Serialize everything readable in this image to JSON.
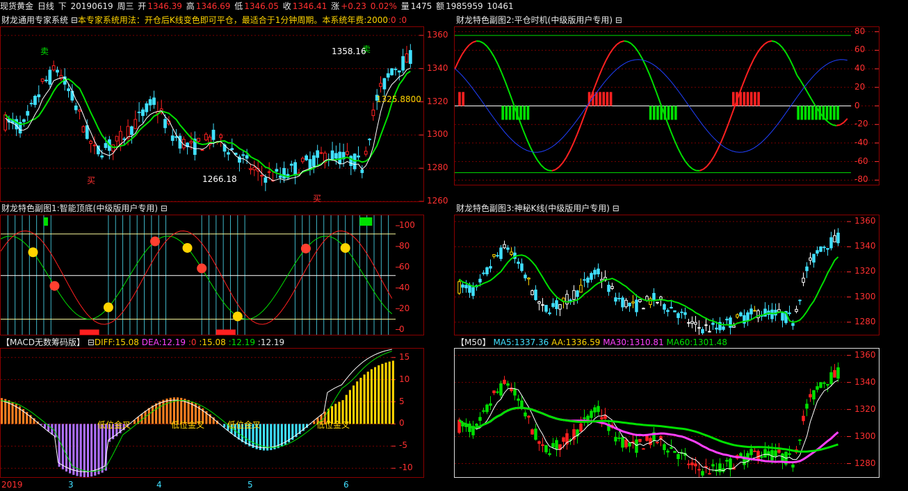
{
  "header": {
    "instrument": "现货黄金",
    "period": "日线",
    "nav": "下",
    "date": "20190619",
    "weekday": "周三",
    "open_label": "开",
    "open": "1346.39",
    "high_label": "高",
    "high": "1346.69",
    "low_label": "低",
    "low": "1346.05",
    "close_label": "收",
    "close": "1346.41",
    "change_label": "涨",
    "change": "+0.23",
    "change_pct": "0.02%",
    "volume_label": "量",
    "volume": "1475",
    "amount_label": "额",
    "amount": "1985959",
    "extra": "10461"
  },
  "main_panel": {
    "title": "财龙通用专家系统",
    "toggle": "⊟",
    "note": "本专家系统用法：开仓后K线变色即可平仓，最适合于1分钟周期。本系统年费:2000",
    "note_v1": ":0",
    "note_v2": ":0",
    "sell_label": "卖",
    "buy_label": "买",
    "label_high": "1358.16",
    "label_low": "1266.18",
    "label_mid": "1325.8800"
  },
  "panel2": {
    "title": "财龙特色副图2:平仓时机(中级版用户专用)",
    "toggle": "⊟"
  },
  "panel1": {
    "title": "财龙特色副图1:智能顶底(中级版用户专用)",
    "toggle": "⊟"
  },
  "panel3": {
    "title": "财龙特色副图3:神秘K线(中级版用户专用)",
    "toggle": "⊟"
  },
  "macd_panel": {
    "title": "【MACD无数筹码版】",
    "toggle": "⊟",
    "diff": "DIFF:15.08",
    "dea": "DEA:12.19",
    "v0": ":0",
    "v1": ":15.08",
    "v2": ":12.19",
    "v3": ":12.19",
    "cross_label": "低位金叉"
  },
  "ma_panel": {
    "title": "【M50】",
    "ma5": "MA5:1337.36",
    "aa": "AA:1336.59",
    "ma30": "MA30:1310.81",
    "ma60": "MA60:1301.48"
  },
  "time_axis": {
    "labels": [
      "2019",
      "3",
      "4",
      "5",
      "6"
    ]
  },
  "chart_data": [
    {
      "type": "candlestick",
      "name": "main",
      "ylim": [
        1260,
        1365
      ],
      "ticks": [
        "1360",
        "1340",
        "1320",
        "1300",
        "1280",
        "1260"
      ]
    },
    {
      "type": "line",
      "name": "panel2",
      "ylim": [
        -85,
        85
      ],
      "ticks": [
        "80",
        "60",
        "40",
        "20",
        "0",
        "-20",
        "-40",
        "-60",
        "-80"
      ]
    },
    {
      "type": "line",
      "name": "panel1",
      "ylim": [
        -5,
        110
      ],
      "ticks": [
        "100",
        "80",
        "60",
        "40",
        "20",
        "0"
      ]
    },
    {
      "type": "candlestick",
      "name": "panel3",
      "ylim": [
        1270,
        1365
      ],
      "ticks": [
        "1360",
        "1340",
        "1320",
        "1300",
        "1280"
      ]
    },
    {
      "type": "bar",
      "name": "macd",
      "ylim": [
        -12,
        17
      ],
      "ticks": [
        "15",
        "10",
        "5",
        "0",
        "-5",
        "-10"
      ]
    },
    {
      "type": "candlestick",
      "name": "ma",
      "ylim": [
        1270,
        1365
      ],
      "ticks": [
        "1360",
        "1340",
        "1320",
        "1300",
        "1280"
      ]
    }
  ],
  "colors": {
    "up": "#ff2020",
    "down": "#40e0ff",
    "grid": "#8b0000",
    "axis": "#ff3030",
    "green": "#00e000",
    "yellow": "#ffd400",
    "magenta": "#ff40ff"
  }
}
